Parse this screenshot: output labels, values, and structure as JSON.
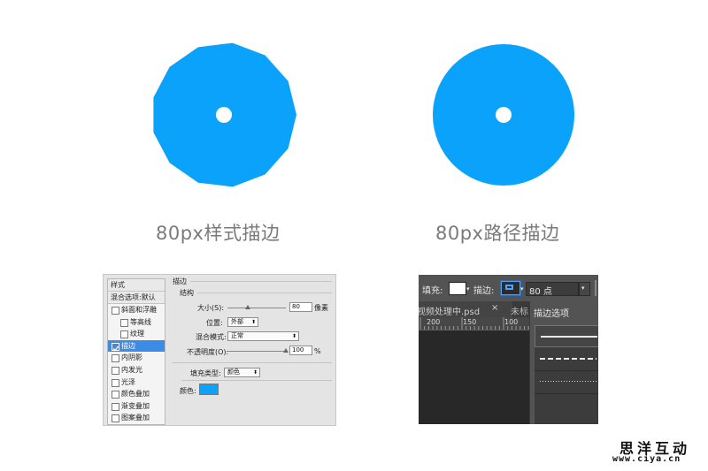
{
  "colors": {
    "accent": "#0aa2fb",
    "selection": "#3c8ce6",
    "ps_dark": "#535353"
  },
  "captions": {
    "left": "80px样式描边",
    "right": "80px路径描边"
  },
  "layer_style_panel": {
    "list_header": "样式",
    "list_subheader": "混合选项:默认",
    "items": [
      {
        "label": "斜面和浮雕",
        "checked": false,
        "selected": false,
        "indent": false
      },
      {
        "label": "等高线",
        "checked": false,
        "selected": false,
        "indent": true
      },
      {
        "label": "纹理",
        "checked": false,
        "selected": false,
        "indent": true
      },
      {
        "label": "描边",
        "checked": true,
        "selected": true,
        "indent": false
      },
      {
        "label": "内阴影",
        "checked": false,
        "selected": false,
        "indent": false
      },
      {
        "label": "内发光",
        "checked": false,
        "selected": false,
        "indent": false
      },
      {
        "label": "光泽",
        "checked": false,
        "selected": false,
        "indent": false
      },
      {
        "label": "颜色叠加",
        "checked": false,
        "selected": false,
        "indent": false
      },
      {
        "label": "渐变叠加",
        "checked": false,
        "selected": false,
        "indent": false
      },
      {
        "label": "图案叠加",
        "checked": false,
        "selected": false,
        "indent": false
      }
    ],
    "stroke": {
      "title": "描边",
      "structure_title": "结构",
      "size_label": "大小(S):",
      "size_value": "80",
      "size_unit": "像素",
      "size_slider": 0.35,
      "position_label": "位置:",
      "position_value": "外部",
      "blend_label": "混合模式:",
      "blend_value": "正常",
      "opacity_label": "不透明度(O):",
      "opacity_value": "100",
      "opacity_unit": "%",
      "opacity_slider": 1.0,
      "fill_type_label": "填充类型:",
      "fill_type_value": "颜色",
      "color_label": "颜色:",
      "color_value": "#0aa2fb"
    }
  },
  "options_bar": {
    "fill_label": "填充:",
    "stroke_label": "描边:",
    "stroke_size": "80 点",
    "tab_active": "视频处理中.psd",
    "tab_close": "×",
    "tab_next": "未标",
    "ruler_ticks": [
      "200",
      "150",
      "100"
    ],
    "popup_title": "描边选项"
  },
  "watermark": {
    "line1": "思洋互动",
    "line2": "www.ciya.cn"
  }
}
